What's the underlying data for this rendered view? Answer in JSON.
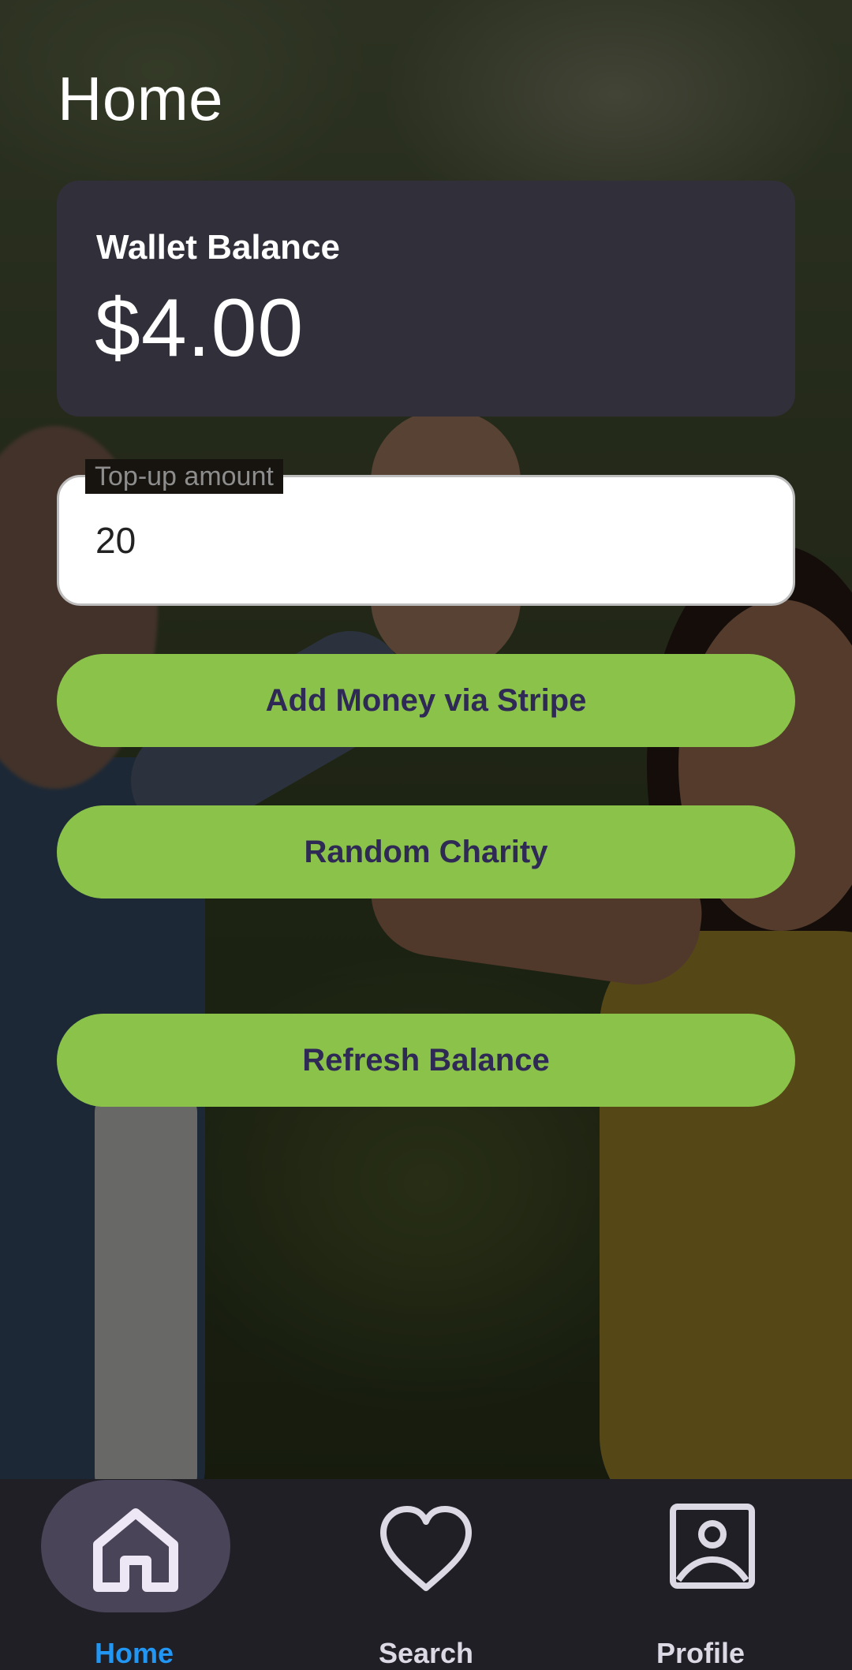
{
  "header": {
    "title": "Home"
  },
  "wallet": {
    "label": "Wallet Balance",
    "amount": "$4.00"
  },
  "topup": {
    "label": "Top-up amount",
    "value": "20"
  },
  "buttons": {
    "add_money": "Add Money via Stripe",
    "random_charity": "Random Charity",
    "refresh_balance": "Refresh Balance"
  },
  "nav": {
    "items": [
      {
        "label": "Home",
        "icon": "home-icon",
        "selected": true
      },
      {
        "label": "Search",
        "icon": "heart-icon",
        "selected": false
      },
      {
        "label": "Profile",
        "icon": "account-box-icon",
        "selected": false
      }
    ]
  },
  "colors": {
    "accent_button": "#8bc34a",
    "button_text": "#2f2a55",
    "card_bg": "#312f39",
    "nav_bg": "#211f26",
    "nav_selected": "#2196f3",
    "nav_pill": "#4a4458"
  }
}
